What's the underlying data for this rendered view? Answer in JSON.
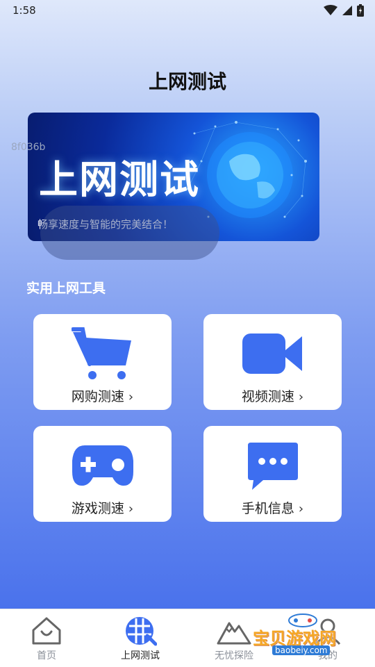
{
  "status": {
    "time": "1:58"
  },
  "header": {
    "title": "上网测试"
  },
  "watermark_code": "8f036b",
  "banner": {
    "title": "上网测试",
    "subtitle": "畅享速度与智能的完美结合！"
  },
  "section": {
    "title": "实用上网工具"
  },
  "tools": [
    {
      "label": "网购测速",
      "icon": "shopping-cart-icon"
    },
    {
      "label": "视频测速",
      "icon": "video-camera-icon"
    },
    {
      "label": "游戏测速",
      "icon": "gamepad-icon"
    },
    {
      "label": "手机信息",
      "icon": "chat-bubble-icon"
    }
  ],
  "chevron": "›",
  "nav": [
    {
      "label": "首页",
      "icon": "home-icon"
    },
    {
      "label": "上网测试",
      "icon": "globe-icon"
    },
    {
      "label": "无忧探险",
      "icon": "mountain-icon"
    },
    {
      "label": "我的",
      "icon": "profile-icon"
    }
  ],
  "watermark": {
    "text": "宝贝游戏网",
    "url": "baobeiy.com"
  },
  "colors": {
    "accent": "#3d6ef0",
    "card_bg": "#ffffff"
  }
}
